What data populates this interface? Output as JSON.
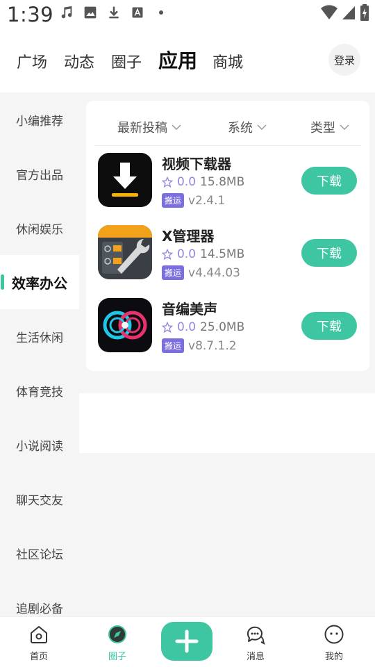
{
  "status_bar": {
    "time": "1:39",
    "left_icons": [
      "music-note-icon",
      "image-icon",
      "download-icon",
      "text-a-icon",
      "dot-icon"
    ],
    "right_icons": [
      "wifi-icon",
      "signal-icon",
      "battery-charging-icon"
    ]
  },
  "top_tabs": [
    "广场",
    "动态",
    "圈子",
    "应用",
    "商城"
  ],
  "active_top_tab": "应用",
  "login_label": "登录",
  "sidebar": {
    "items": [
      "小编推荐",
      "官方出品",
      "休闲娱乐",
      "效率办公",
      "生活休闲",
      "体育竞技",
      "小说阅读",
      "聊天交友",
      "社区论坛",
      "追剧必备"
    ],
    "active": "效率办公"
  },
  "filters": [
    "最新投稿",
    "系统",
    "类型"
  ],
  "apps": [
    {
      "name": "视频下载器",
      "rating": "0.0",
      "size": "15.8MB",
      "tag": "搬运",
      "version": "v2.4.1",
      "button": "下载",
      "icon": "video-downloader-icon"
    },
    {
      "name": "X管理器",
      "rating": "0.0",
      "size": "14.5MB",
      "tag": "搬运",
      "version": "v4.44.03",
      "button": "下载",
      "icon": "x-manager-icon"
    },
    {
      "name": "音编美声",
      "rating": "0.0",
      "size": "25.0MB",
      "tag": "搬运",
      "version": "v8.7.1.2",
      "button": "下载",
      "icon": "audio-editor-icon"
    }
  ],
  "bottom_nav": [
    {
      "label": "首页",
      "icon": "home-icon"
    },
    {
      "label": "圈子",
      "icon": "compass-icon"
    },
    {
      "label": "消息",
      "icon": "chat-bubbles-icon"
    },
    {
      "label": "我的",
      "icon": "face-icon"
    }
  ],
  "active_bottom_nav": "圈子",
  "colors": {
    "accent": "#3ec5a1",
    "tag": "#7b6fe0",
    "rating": "#8f86e3"
  }
}
